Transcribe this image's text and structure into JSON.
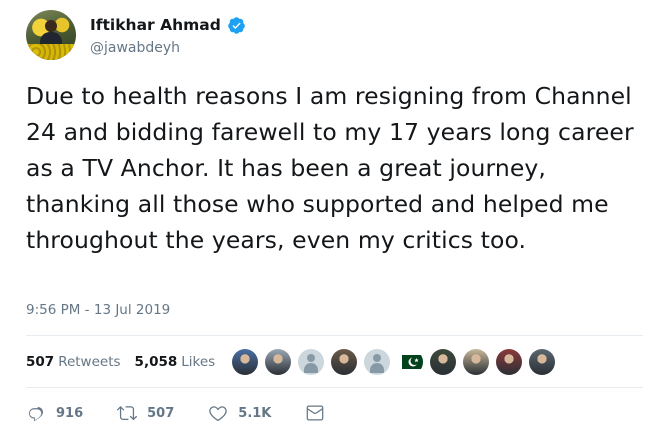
{
  "author": {
    "display_name": "Iftikhar Ahmad",
    "handle": "@jawabdeyh",
    "verified": true,
    "verified_color": "#1da1f2",
    "avatar_icon": "profile-photo"
  },
  "tweet": {
    "text": "Due to health reasons I am resigning from Channel 24 and bidding farewell to my 17 years long career as a TV Anchor. It has been a great journey, thanking all those who supported and helped me throughout the years, even my critics too.",
    "timestamp": "9:56 PM - 13 Jul 2019"
  },
  "stats": {
    "retweets_count": "507",
    "retweets_label": "Retweets",
    "likes_count": "5,058",
    "likes_label": "Likes",
    "liker_avatars": [
      {
        "type": "photo",
        "color": "#4a6fa5"
      },
      {
        "type": "photo",
        "color": "#9aa9b5"
      },
      {
        "type": "default",
        "color": "#ccd6dd"
      },
      {
        "type": "photo",
        "color": "#6b5a48"
      },
      {
        "type": "default",
        "color": "#ccd6dd"
      },
      {
        "type": "flag",
        "color": "#01411c"
      },
      {
        "type": "photo",
        "color": "#3d4a3a"
      },
      {
        "type": "photo",
        "color": "#c9b89a"
      },
      {
        "type": "photo",
        "color": "#8a3a3a"
      },
      {
        "type": "photo",
        "color": "#5b6770"
      }
    ]
  },
  "actions": {
    "reply_count": "916",
    "retweet_count": "507",
    "like_count": "5.1K",
    "reply_icon": "reply-icon",
    "retweet_icon": "retweet-icon",
    "like_icon": "heart-icon",
    "dm_icon": "envelope-icon"
  },
  "colors": {
    "text": "#14171a",
    "secondary": "#657786",
    "divider": "#e6ecf0",
    "accent": "#1da1f2"
  }
}
